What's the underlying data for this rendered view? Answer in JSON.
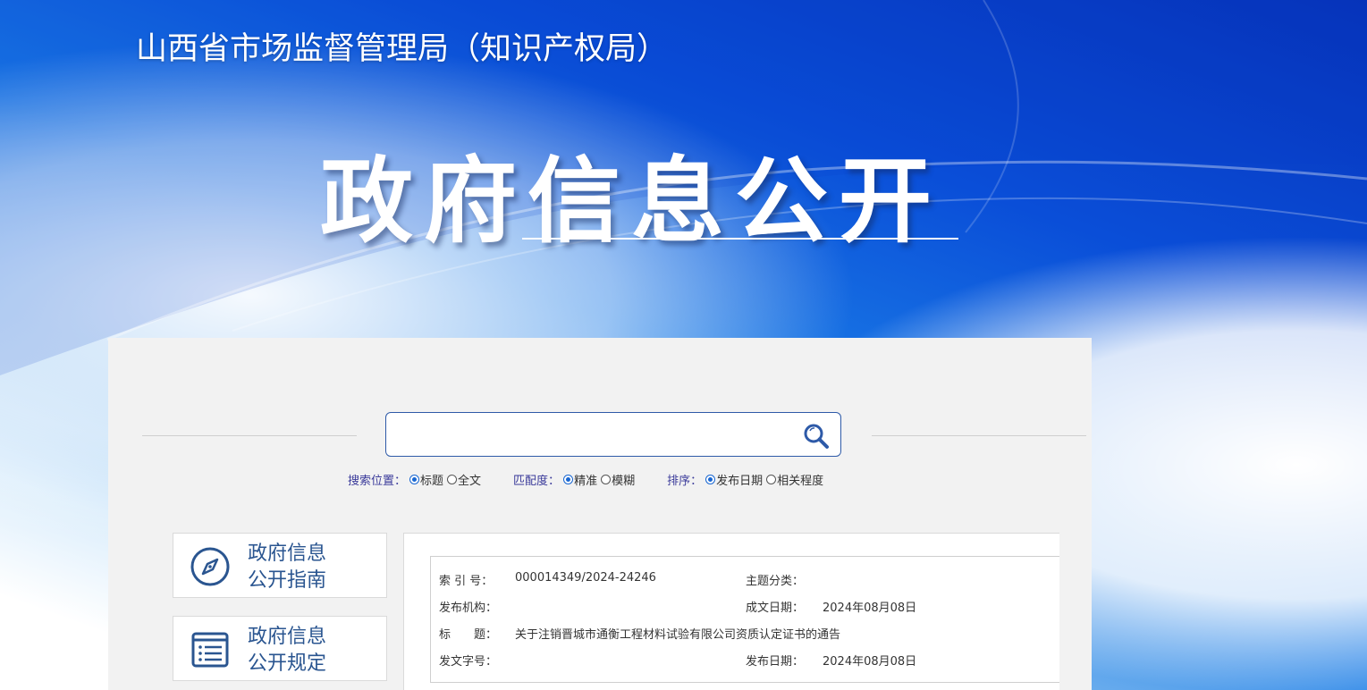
{
  "header": {
    "org_title": "山西省市场监督管理局（知识产权局）",
    "hero_title": "政府信息公开"
  },
  "search": {
    "placeholder": "",
    "value": "",
    "options": {
      "position": {
        "label": "搜索位置：",
        "choices": [
          "标题",
          "全文"
        ],
        "selected": "标题"
      },
      "match": {
        "label": "匹配度：",
        "choices": [
          "精准",
          "模糊"
        ],
        "selected": "精准"
      },
      "sort": {
        "label": "排序：",
        "choices": [
          "发布日期",
          "相关程度"
        ],
        "selected": "发布日期"
      }
    }
  },
  "sidebar": {
    "items": [
      {
        "line1": "政府信息",
        "line2": "公开指南",
        "icon": "compass-icon"
      },
      {
        "line1": "政府信息",
        "line2": "公开规定",
        "icon": "document-list-icon"
      }
    ]
  },
  "detail": {
    "index_label": "索 引 号：",
    "index_value": "000014349/2024-24246",
    "topic_label": "主题分类：",
    "topic_value": "",
    "publisher_label": "发布机构：",
    "publisher_value": "",
    "created_label": "成文日期：",
    "created_value": "2024年08月08日",
    "title_label": "标　　题：",
    "title_value": "关于注销晋城市通衡工程材料试验有限公司资质认定证书的通告",
    "docno_label": "发文字号：",
    "docno_value": "",
    "pubdate_label": "发布日期：",
    "pubdate_value": "2024年08月08日"
  },
  "colors": {
    "banner_blue": "#0a4ed8",
    "panel_bg": "#f2f2f2",
    "accent": "#2a5590",
    "radio_checked": "#1967d2"
  }
}
